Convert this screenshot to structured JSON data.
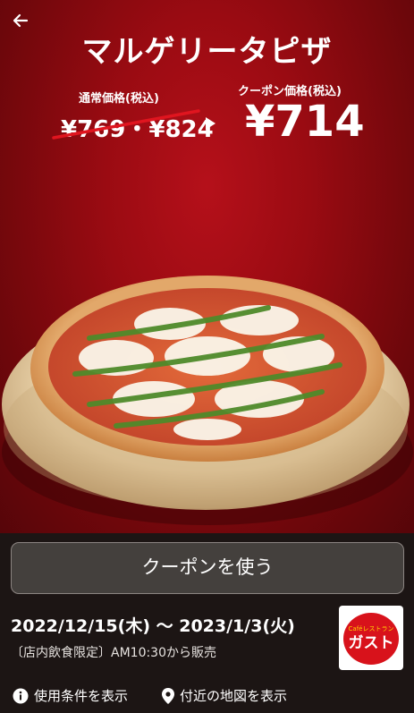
{
  "header": {
    "back_icon": "arrow-left-icon",
    "title": "マルゲリータピザ"
  },
  "pricing": {
    "regular_label": "通常価格(税込)",
    "regular_price": "¥769・¥824",
    "coupon_label": "クーポン価格(税込)",
    "coupon_price": "¥714"
  },
  "actions": {
    "use_coupon_label": "クーポンを使う"
  },
  "details": {
    "period": "2022/12/15(木) 〜 2023/1/3(火)",
    "note": "〔店内飲食限定〕AM10:30から販売"
  },
  "brand": {
    "logo_small_text": "Caféレストラン",
    "logo_main_text": "ガスト"
  },
  "links": {
    "terms_label": "使用条件を表示",
    "map_label": "付近の地図を表示"
  },
  "colors": {
    "hero_red": "#9a0b12",
    "strike_red": "#e0151f",
    "logo_red": "#d8121b"
  }
}
